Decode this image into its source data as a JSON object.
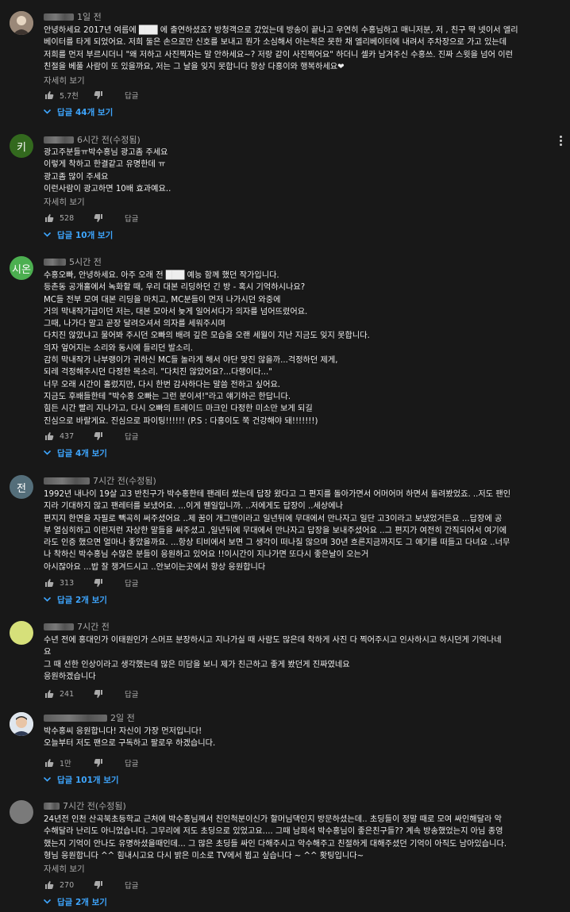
{
  "comments": [
    {
      "time": "1일 전",
      "avatar_letter": "",
      "avatar_color": "#8c7b6a",
      "text": "안녕하세요 2017년 여름에 ███ 에 출연하셨죠? 방청객으로 갔었는데 방송이 끝나고 우연히 수홍님하고 매니저분, 저 , 친구 딱 넷이서 엘리\n베이터를 타게 되었어요. 저희 둘은 손으로만 신호를 보내고 뭔가 소심해서 아는척은 못한 채 엘리베이터에 내려서 주차장으로 가고 있는데\n저희를 먼저 부르시더니 \"왜 저하고 사진찍자는 말 안하세요~? 저랑 같이 사진찍어요\" 하더니 셀카 남겨주신 수홍쓰. 진짜 스윗을 넘어 이런\n친절을 베풀 사람이 또 있을까요, 저는 그 날을 잊지 못합니다 항상 다홍이와 행복하세요❤",
      "more": "자세히 보기",
      "likes": "5.7천",
      "reply_label": "답글",
      "replies": "답글 44개 보기"
    },
    {
      "time": "6시간 전(수정됨)",
      "avatar_letter": "키",
      "avatar_color": "#33691e",
      "text": "광고주분들ㅠ박수홍님 광고좀 주세요\n이렇게 착하고 한결같고 유명한데 ㅠ\n광고좀 많이 주세요\n이런사람이 광고하면 10배 효과예요..",
      "more": "자세히 보기",
      "likes": "528",
      "reply_label": "답글",
      "replies": "답글 10개 보기"
    },
    {
      "time": "5시간 전",
      "avatar_letter": "시온",
      "avatar_color": "#4caf50",
      "text": "수홍오빠, 안녕하세요. 아주 오래 전 ███ 예능 함께 했던 작가입니다.\n등촌동 공개홀에서 녹화할 때, 우리 대본 리딩하던 긴 방 - 혹시 기억하시나요?\nMC들 전부 모여 대본 리딩을 마치고, MC분들이 먼저 나가시던 와중에\n거의 막내작가급이던 저는, 대본 모아서 늦게 일어서다가 의자를 넘어뜨렸어요.\n그때, 나가다 말고 곧장 달려오셔서 의자를 세워주시며\n다치진 않았냐고 물어봐 주시던 오빠의 배려 깊은 모습을 오랜 세월이 지난 지금도 잊지 못합니다.\n의자 엎어지는 소리와 동시에 들리던 발소리.\n감히 막내작가 나부랭이가 귀하신 MC들 놀라게 해서 야단 맞진 않을까...걱정하던 제게,\n되레 걱정해주시던 다정한 목소리. \"다치진 않았어요?...다행이다...\"\n너무 오래 시간이 흘렀지만, 다시 한번 감사하다는 말씀 전하고 싶어요.\n지금도 후배들한테 \"박수홍 오빠는 그런 분이셔!\"라고 얘기하곤 한답니다.\n힘든 시간 빨리 지나가고, 다시 오빠의 트레이드 마크인 다정한 미소만 보게 되길\n진심으로 바랄게요. 진심으로 파이팅!!!!!! (P.S : 다홍이도 쭉 건강해야 돼!!!!!!!)",
      "more": "",
      "likes": "437",
      "reply_label": "답글",
      "replies": "답글 4개 보기"
    },
    {
      "time": "7시간 전(수정됨)",
      "avatar_letter": "전",
      "avatar_color": "#546e7a",
      "text": "1992년 내나이 19살 고3 반친구가 박수홍한테 팬레터 썼는데 답장 왔다고 그 편지를 돌아가면서 어머어머 하면서 돌려봤었죠. ..저도 팬인\n지라 기대하지 않고 팬레터를 보냈어요. ...이게 웬일입니까. ..저에게도 답장이 ..세상에나\n편지지 한면을 자필로 빽곡히 써주셨어요 ..제 꿈이 개그맨이라고 일년뒤에 무대에서 만나자고 일단 고3이라고 보냈었거든요 ...답장에 공\n부 열심히하고 이런저런 자상한 말들을 써주셨고 ,일년뒤에 무대에서 만나자고 답장을 보내주셨어요 ..그 편지가 여전히 간직되어서 여기에\n라도 인증 했으면 얼마나 좋았을까요. ...항상 티비에서 보면 그 생각이 떠나질 않으며 30년 흐른지금까지도 그 얘기를 떠들고 다녀요 ..너무\n나 착하신 박수홍님 수많은 분들이 응원하고 있어요 !!이시간이 지나가면 또다시 좋은날이 오는거\n 아시잖아요 ...밥 잘 챙겨드시고 ..안보이는곳에서 항상 응원합니다",
      "more": "",
      "likes": "313",
      "reply_label": "답글",
      "replies": "답글 2개 보기"
    },
    {
      "time": "7시간 전",
      "avatar_letter": "",
      "avatar_color": "#d6e07a",
      "text": "수년 전에 홍대인가 이태원인가 스머프 분장하시고 지나가실 때 사람도 많은데 착하게 사진 다 찍어주시고 인사하시고 하시던게 기억나네\n요\n그 때 선한 인상이라고 생각했는데 많은 미담을 보니 제가 친근하고 좋게 봤던게 진짜였네요\n응원하겠습니다",
      "more": "",
      "likes": "241",
      "reply_label": "답글",
      "replies": ""
    },
    {
      "time": "2일 전",
      "avatar_letter": "",
      "avatar_color": "#e8d8c8",
      "text": "박수홍씨 응원합니다! 자신이 가장 먼저입니다!\n오늘부터 저도 팬으로 구독하고 팔로우 하겠습니다.",
      "more": "",
      "likes": "1만",
      "reply_label": "답글",
      "replies": "답글 101개 보기"
    },
    {
      "time": "7시간 전(수정됨)",
      "avatar_letter": "",
      "avatar_color": "#7a7a7a",
      "text": "24년전 인천 산곡북초등학교 근처에 박수홍님께서 친인척분이신가 할머님댁인지 방문하셨는데.. 초딩들이 정말 때로 모여 싸인해달라 악\n수해달라 난리도 아니었습니다. 그무리에 저도 초딩으로 있었고요.... 그때 남희석 박수홍님이 좋은친구들?? 계속 방송했었는지 아님 종영\n했는지 기억이 안나도 유명하셨을때인데... 그 많은 초딩들 싸인 다해주시고 악수해주고 친절하게 대해주셨던 기억이 아직도 남아있습니다.\n형님 응원합니다 ^^ 힘내시고요 다시 밝은 미소로 TV에서 뵙고 싶습니다 ~ ^^ 홧팅입니다~",
      "more": "자세히 보기",
      "likes": "270",
      "reply_label": "답글",
      "replies": "답글 2개 보기"
    }
  ]
}
